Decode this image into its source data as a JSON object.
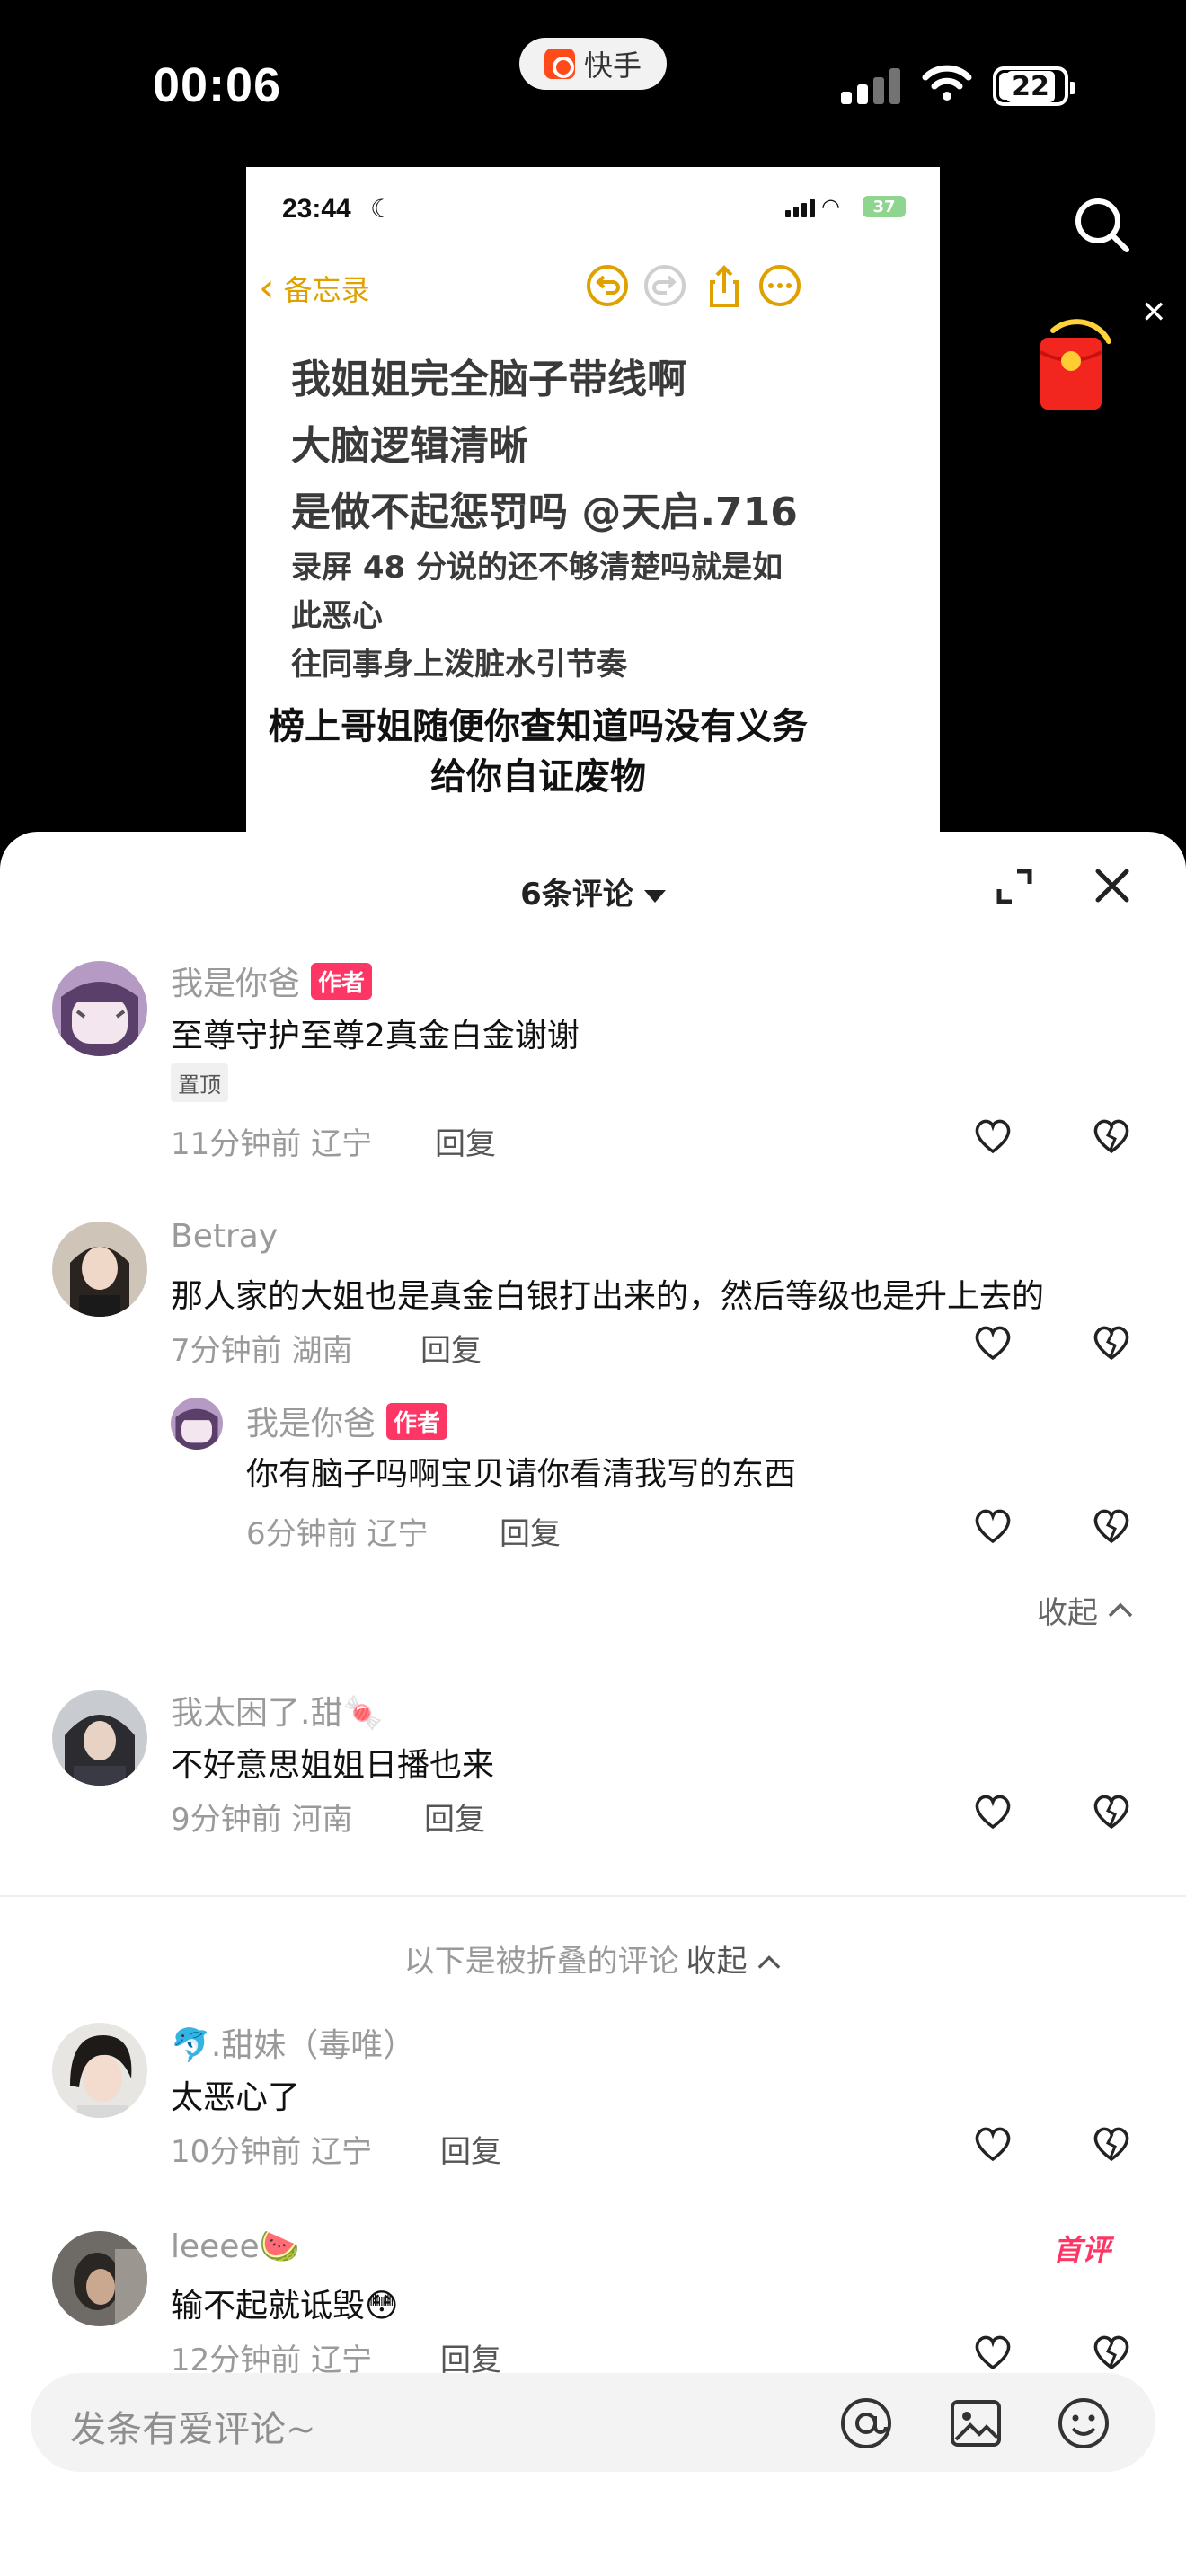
{
  "status": {
    "time": "00:06",
    "battery": "22"
  },
  "app": {
    "name": "快手"
  },
  "notes": {
    "time": "23:44",
    "battery": "37",
    "back_label": "备忘录",
    "lines": [
      "我姐姐完全脑子带线啊",
      "大脑逻辑清晰",
      "是做不起惩罚吗 @天启.716",
      "录屏 48 分说的还不够清楚吗就是如",
      "此恶心",
      "往同事身上泼脏水引节奏",
      "榜上哥姐随便你查知道吗没有义务",
      "给你自证废物"
    ]
  },
  "sheet": {
    "title": "6条评论"
  },
  "comments": [
    {
      "name": "我是你爸",
      "tag": "作者",
      "text": "至尊守护至尊2真金白金谢谢",
      "pinned": "置顶",
      "meta": "11分钟前 辽宁",
      "reply": "回复"
    },
    {
      "name": "Betray",
      "text": "那人家的大姐也是真金白银打出来的，然后等级也是升上去的",
      "meta": "7分钟前 湖南",
      "reply": "回复"
    },
    {
      "name": "我是你爸",
      "tag": "作者",
      "text": "你有脑子吗啊宝贝请你看清我写的东西",
      "meta": "6分钟前 辽宁",
      "reply": "回复"
    },
    {
      "name": "我太困了.甜🍬",
      "text": "不好意思姐姐日播也来",
      "meta": "9分钟前 河南",
      "reply": "回复"
    },
    {
      "name": "🐬.甜妹（毒唯）",
      "text": "太恶心了",
      "meta": "10分钟前 辽宁",
      "reply": "回复"
    },
    {
      "name": "leeee🍉",
      "text": "输不起就诋毁😳",
      "meta": "12分钟前 辽宁",
      "reply": "回复",
      "badge": "首评"
    }
  ],
  "collapse_label": "收起",
  "folded": {
    "hint": "以下是被折叠的评论",
    "action": "收起"
  },
  "input": {
    "placeholder": "发条有爱评论~"
  }
}
